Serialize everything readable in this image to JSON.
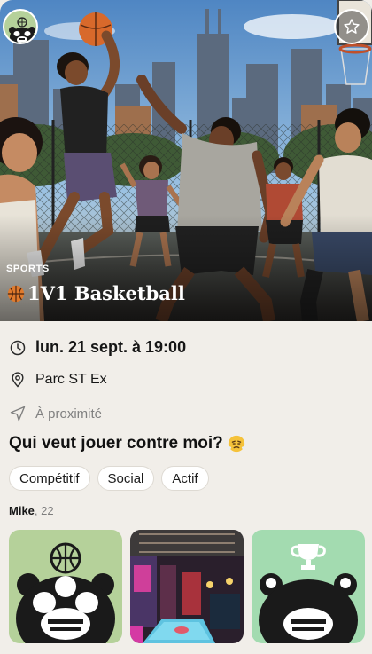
{
  "event": {
    "category": "SPORTS",
    "title_emoji": "basketball-icon",
    "title": "1V1 Basketball",
    "datetime": "lun. 21 sept. à 19:00",
    "location": "Parc ST Ex",
    "proximity": "À proximité",
    "description": "Qui veut jouer contre moi?",
    "description_emoji": "steam-face-icon"
  },
  "tags": [
    "Compétitif",
    "Social",
    "Actif"
  ],
  "host": {
    "name": "Mike",
    "age": ", 22"
  },
  "photos": [
    {
      "name": "panda-basketball-avatar"
    },
    {
      "name": "arcade-bar-photo"
    },
    {
      "name": "panda-trophy-avatar"
    }
  ],
  "colors": {
    "background": "#f1eee9",
    "avatar_green": "#b5d19a",
    "tag_bg": "#ffffff",
    "muted_text": "#808080"
  }
}
